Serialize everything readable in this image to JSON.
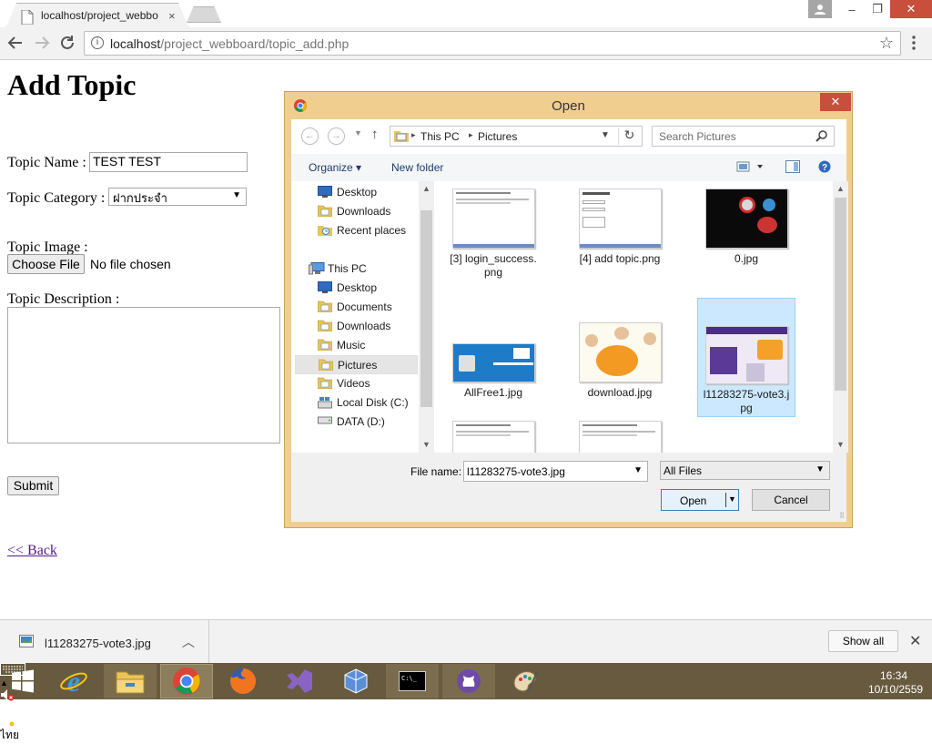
{
  "browser": {
    "tab_title": "localhost/project_webbo",
    "tab_close": "×",
    "url_host": "localhost",
    "url_path": "/project_webboard/topic_add.php",
    "window_controls": {
      "minimize": "–",
      "restore": "❐",
      "close": "✕"
    }
  },
  "page": {
    "title": "Add Topic",
    "topic_name_label": "Topic Name :",
    "topic_name_value": "TEST TEST",
    "topic_category_label": "Topic Category :",
    "topic_category_value": "ฝากประจำ",
    "topic_image_label": "Topic Image :",
    "choose_file_label": "Choose File",
    "no_file_text": "No file chosen",
    "topic_description_label": "Topic Description :",
    "description_value": "",
    "submit_label": "Submit",
    "back_link": "<< Back"
  },
  "dialog": {
    "title": "Open",
    "close": "✕",
    "breadcrumb": [
      "This PC",
      "Pictures"
    ],
    "search_placeholder": "Search Pictures",
    "organize_label": "Organize ▾",
    "new_folder_label": "New folder",
    "nav_items": [
      {
        "label": "Desktop",
        "icon": "desktop-icon",
        "level": "sub"
      },
      {
        "label": "Downloads",
        "icon": "downloads-folder-icon",
        "level": "sub"
      },
      {
        "label": "Recent places",
        "icon": "recent-places-icon",
        "level": "sub"
      },
      {
        "label": "This PC",
        "icon": "computer-icon",
        "level": "top"
      },
      {
        "label": "Desktop",
        "icon": "desktop-icon",
        "level": "sub"
      },
      {
        "label": "Documents",
        "icon": "documents-folder-icon",
        "level": "sub"
      },
      {
        "label": "Downloads",
        "icon": "downloads-folder-icon",
        "level": "sub"
      },
      {
        "label": "Music",
        "icon": "music-folder-icon",
        "level": "sub"
      },
      {
        "label": "Pictures",
        "icon": "pictures-folder-icon",
        "level": "sub",
        "selected": true
      },
      {
        "label": "Videos",
        "icon": "videos-folder-icon",
        "level": "sub"
      },
      {
        "label": "Local Disk (C:)",
        "icon": "local-disk-icon",
        "level": "sub"
      },
      {
        "label": "DATA (D:)",
        "icon": "drive-icon",
        "level": "sub"
      }
    ],
    "files": [
      {
        "name": "[3] login_success.png",
        "thumb": "screenshot"
      },
      {
        "name": "[4] add topic.png",
        "thumb": "screenshot-form"
      },
      {
        "name": "0.jpg",
        "thumb": "dark-graphic"
      },
      {
        "name": "AllFree1.jpg",
        "thumb": "blue-banner"
      },
      {
        "name": "download.jpg",
        "thumb": "cartoon"
      },
      {
        "name": "l11283275-vote3.jpg",
        "thumb": "purple-promo",
        "selected": true
      },
      {
        "name": "",
        "thumb": "screenshot"
      },
      {
        "name": "",
        "thumb": "screenshot"
      }
    ],
    "filename_label": "File name:",
    "filename_value": "l11283275-vote3.jpg",
    "filetype_value": "All Files",
    "open_label": "Open",
    "cancel_label": "Cancel"
  },
  "downloads": {
    "file_name": "l11283275-vote3.jpg",
    "show_all_label": "Show all",
    "close": "✕"
  },
  "taskbar": {
    "apps": [
      "start-icon",
      "internet-explorer-icon",
      "file-explorer-icon",
      "chrome-icon",
      "firefox-icon",
      "visual-studio-icon",
      "virtualbox-icon",
      "command-prompt-icon",
      "github-icon",
      "paint-icon"
    ],
    "language": "ไทย",
    "time": "16:34",
    "date": "10/10/2559"
  }
}
